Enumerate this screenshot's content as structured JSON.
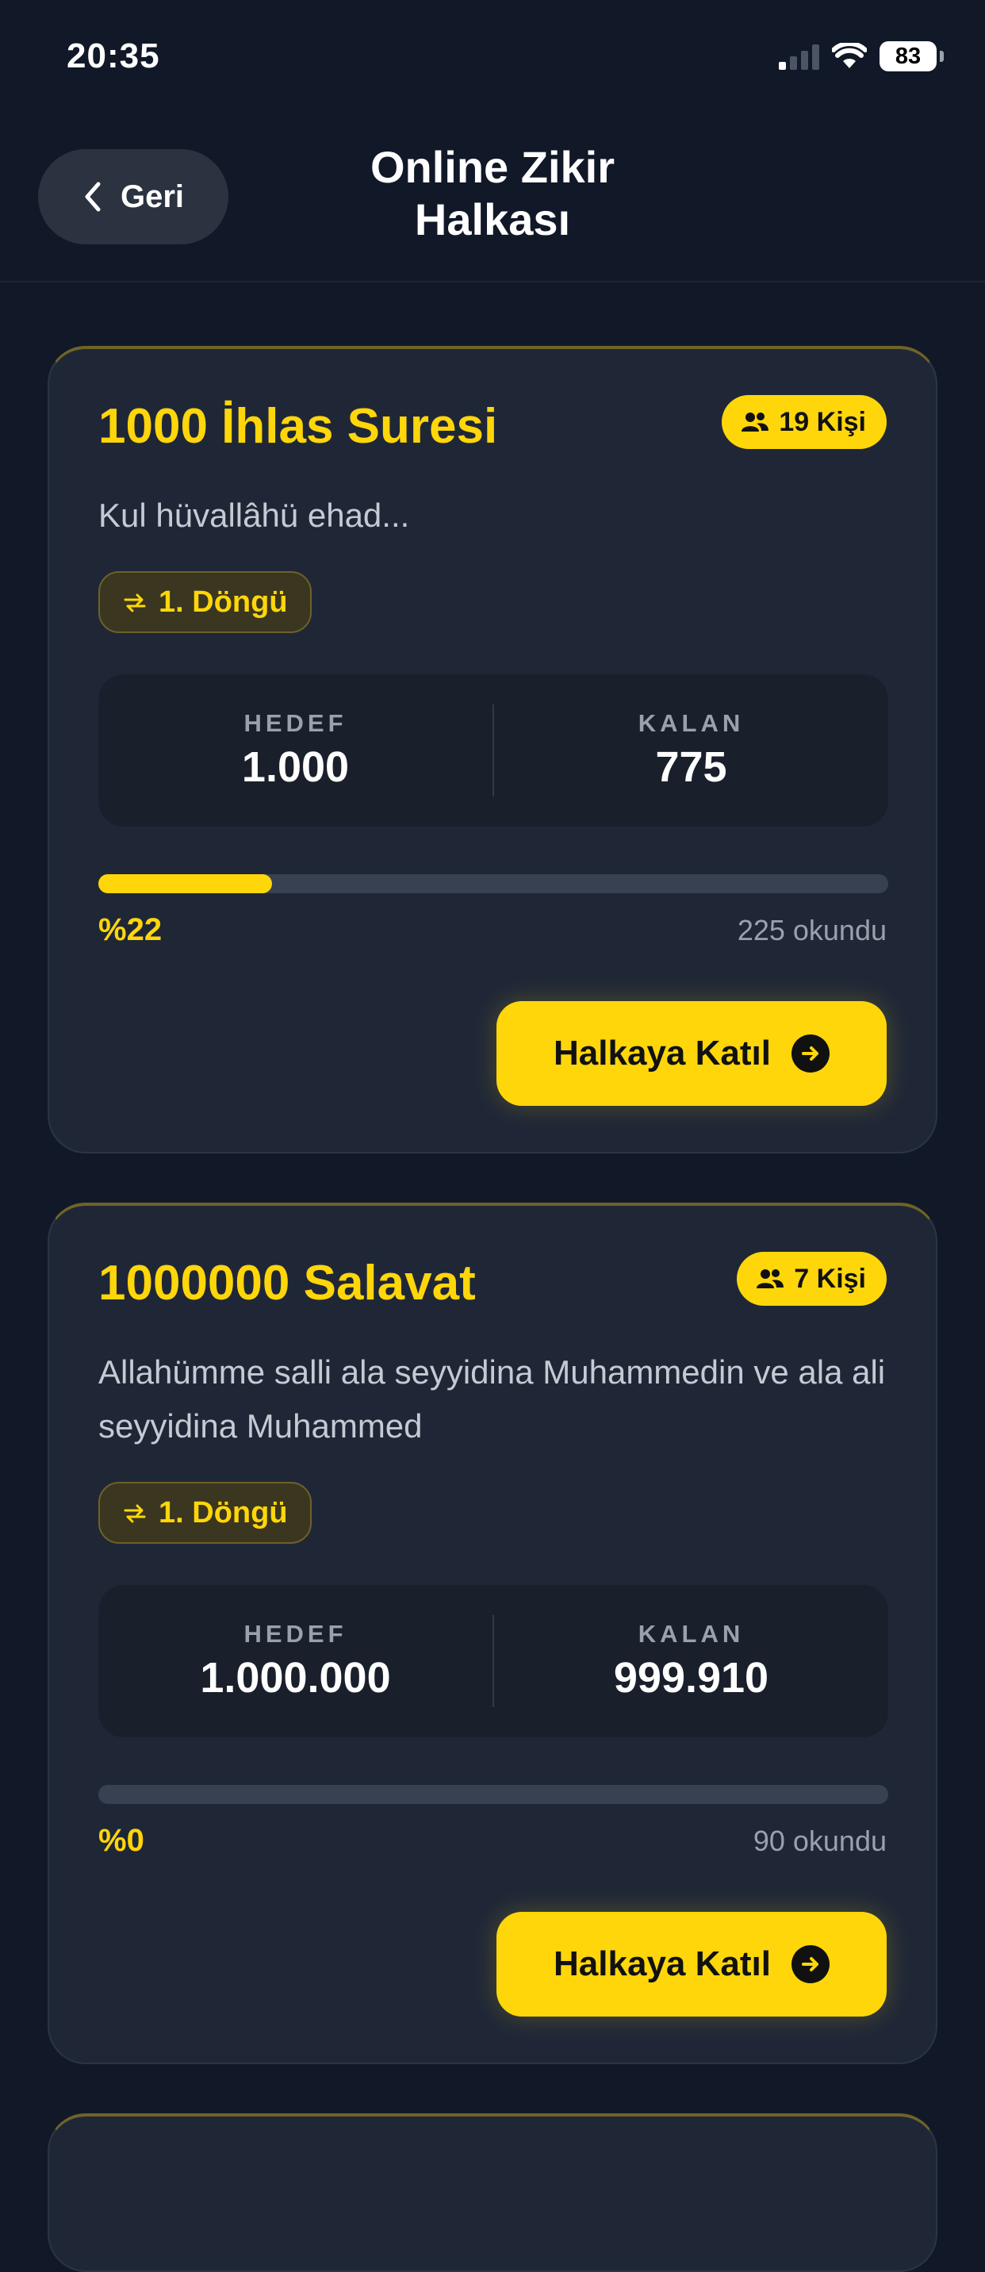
{
  "status_bar": {
    "time": "20:35",
    "battery": "83",
    "icons": [
      "signal-icon",
      "wifi-icon",
      "battery-icon"
    ]
  },
  "header": {
    "back_label": "Geri",
    "title": "Online Zikir\nHalkası"
  },
  "colors": {
    "background": "#111827",
    "card": "#1f2737",
    "accent": "#ffd60a"
  },
  "cards": [
    {
      "title": "1000 İhlas Suresi",
      "participants": "19 Kişi",
      "description": "Kul hüvallâhü ehad...",
      "cycle": "1. Döngü",
      "target_label": "HEDEF",
      "target_value": "1.000",
      "remaining_label": "KALAN",
      "remaining_value": "775",
      "percent_label": "%22",
      "progress": 0.22,
      "read_count": "225 okundu",
      "join_label": "Halkaya Katıl"
    },
    {
      "title": "1000000 Salavat",
      "participants": "7 Kişi",
      "description": "Allahümme salli ala seyyidina Muhammedin ve ala ali seyyidina Muhammed",
      "cycle": "1. Döngü",
      "target_label": "HEDEF",
      "target_value": "1.000.000",
      "remaining_label": "KALAN",
      "remaining_value": "999.910",
      "percent_label": "%0",
      "progress": 0,
      "read_count": "90 okundu",
      "join_label": "Halkaya Katıl"
    }
  ]
}
